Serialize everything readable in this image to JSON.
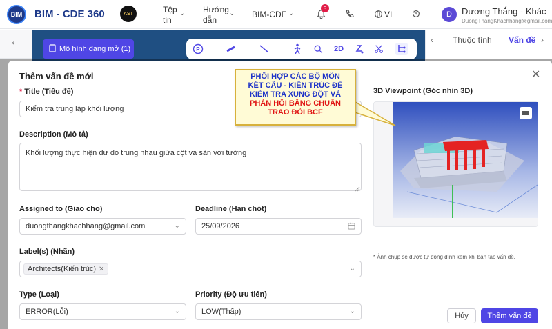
{
  "app": {
    "brand": "BIM - CDE 360",
    "logo_text": "BIM",
    "partner_logo_text": "AST"
  },
  "topnav": {
    "file_line1": "Tệp",
    "file_line2": "tin",
    "guide_line1": "Hướng",
    "guide_line2": "dẫn",
    "bimcde": "BIM-CDE",
    "notif_count": "5",
    "lang": "VI",
    "user_initial": "D",
    "user_name": "Dương Thắng - Khác",
    "user_email": "DuongThangKhachhang@gmail.com"
  },
  "workspace": {
    "model_open": "Mô hình đang mở (1)",
    "toolbar_2d": "2D",
    "tab_properties": "Thuộc tính",
    "tab_issues": "Vấn đề"
  },
  "modal": {
    "title": "Thêm vấn đề mới",
    "title_label": "Title (Tiêu đề)",
    "title_value": "Kiểm tra trùng lặp khối lượng",
    "desc_label": "Description (Mô tả)",
    "desc_value": "Khối lượng thực hiện dư do trùng nhau giữa cột và sàn với tường",
    "assigned_label": "Assigned to (Giao cho)",
    "assigned_value": "duongthangkhachhang@gmail.com",
    "deadline_label": "Deadline (Hạn chót)",
    "deadline_value": "25/09/2026",
    "labels_label": "Label(s) (Nhãn)",
    "labels_chip": "Architects(Kiến trúc)",
    "type_label": "Type (Loại)",
    "type_value": "ERROR(Lỗi)",
    "priority_label": "Priority (Độ ưu tiên)",
    "priority_value": "LOW(Thấp)",
    "viewpoint_label": "3D Viewpoint (Góc nhìn 3D)",
    "viewpoint_note": "* Ảnh chụp sẽ được tự động đính kèm khi bạn tạo vấn đề.",
    "cancel": "Hủy",
    "submit": "Thêm vấn đề"
  },
  "callout": {
    "line1": "PHỐI HỢP CÁC BỘ MÔN",
    "line2": "KẾT CẤU - KIẾN TRÚC ĐỂ",
    "line3": "KIỂM TRA XUNG ĐỘT VÀ",
    "line4": "PHẢN HỒI BẰNG CHUẨN",
    "line5": "TRAO ĐỔI BCF"
  },
  "colors": {
    "accent": "#4f46e5",
    "brand": "#1e3a8a",
    "highlight": "#e01414"
  }
}
